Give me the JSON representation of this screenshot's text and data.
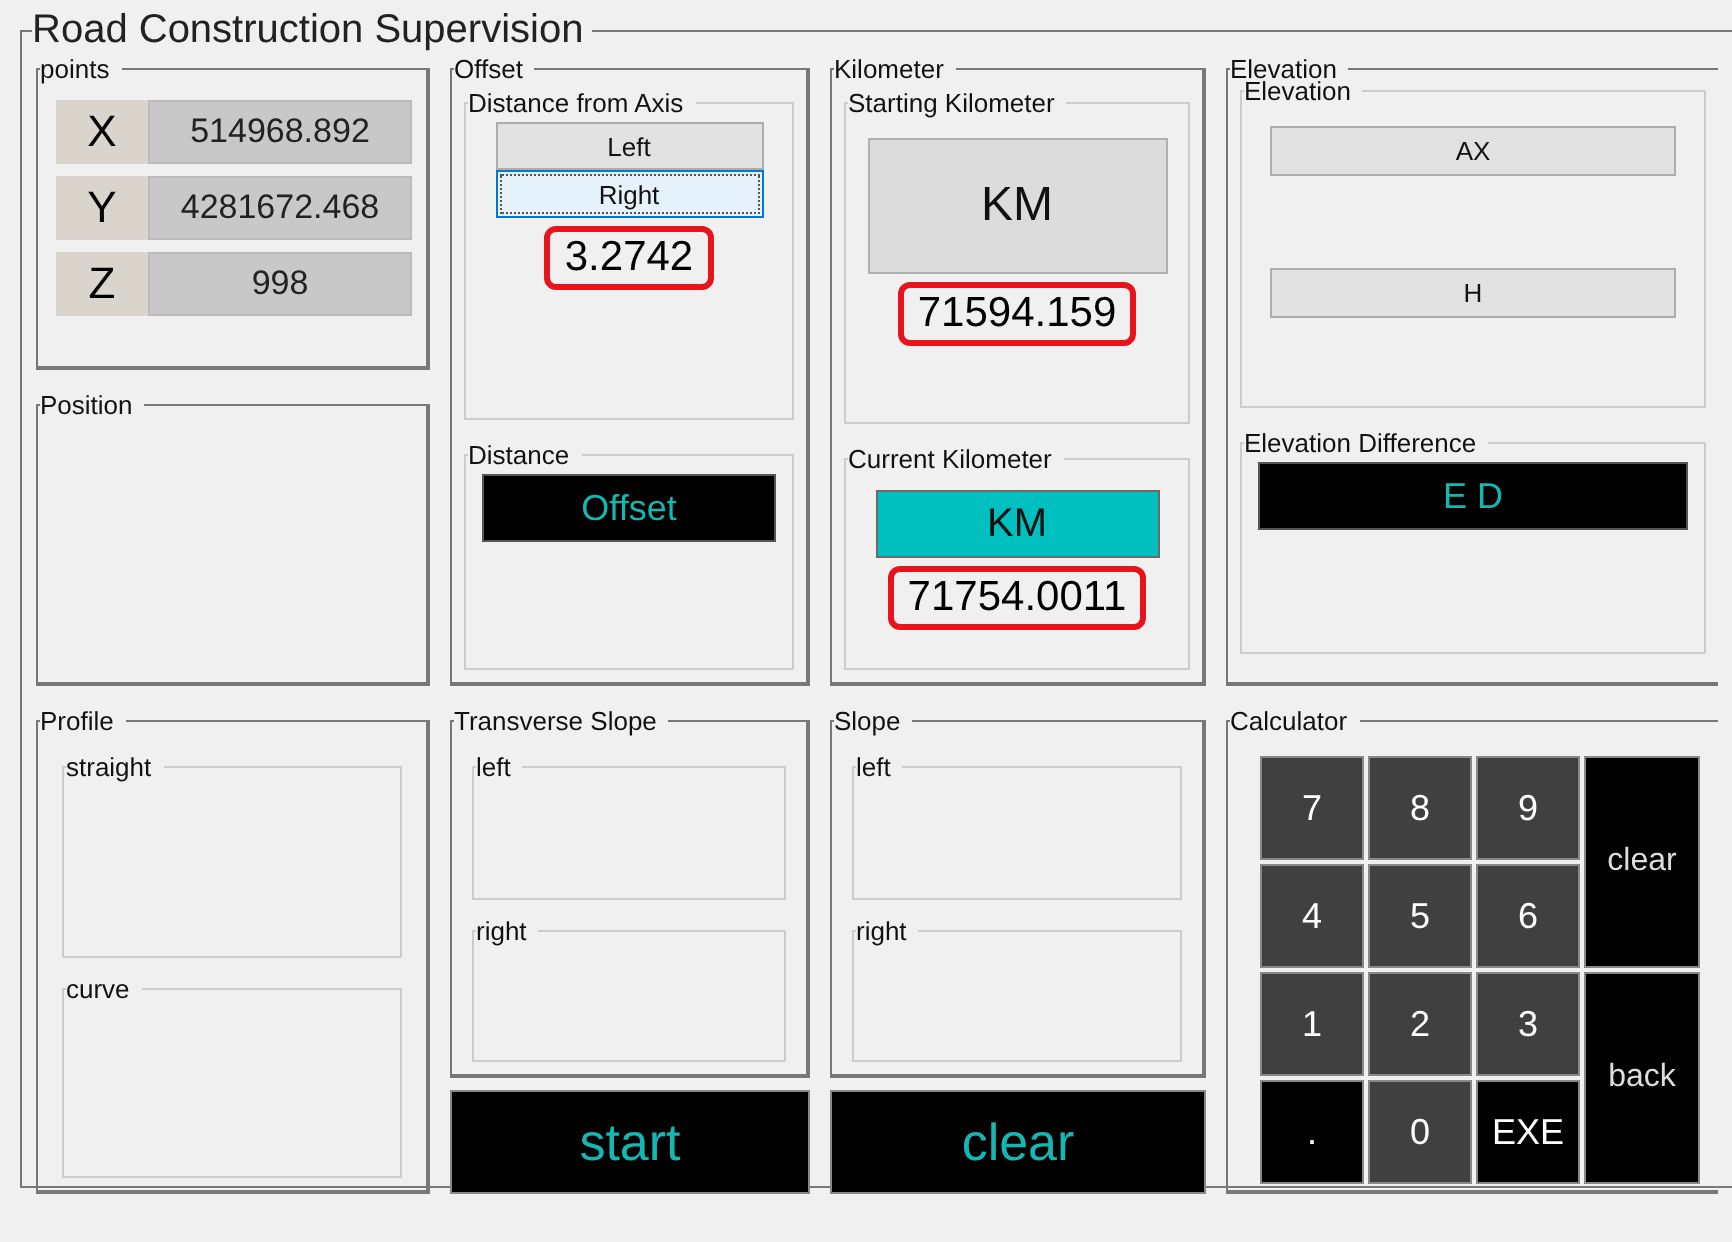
{
  "window": {
    "title": "Road Construction Supervision"
  },
  "points": {
    "title": "points",
    "rows": [
      {
        "axis": "X",
        "value": "514968.892"
      },
      {
        "axis": "Y",
        "value": "4281672.468"
      },
      {
        "axis": "Z",
        "value": "998"
      }
    ]
  },
  "position": {
    "title": "Position"
  },
  "offset": {
    "title": "Offset",
    "distance_from_axis": {
      "title": "Distance from Axis",
      "buttons": [
        {
          "label": "Left",
          "selected": false
        },
        {
          "label": "Right",
          "selected": true
        }
      ],
      "value": "3.2742",
      "highlighted": true
    },
    "distance": {
      "title": "Distance",
      "display": "Offset"
    }
  },
  "kilometer": {
    "title": "Kilometer",
    "sections": [
      {
        "title": "Starting Kilometer",
        "button": "KM",
        "active": false,
        "value": "71594.159",
        "highlighted": true
      },
      {
        "title": "Current Kilometer",
        "button": "KM",
        "active": true,
        "value": "71754.0011",
        "highlighted": true
      }
    ]
  },
  "elevation": {
    "title": "Elevation",
    "inner": {
      "title": "Elevation",
      "buttons": [
        "AX",
        "H"
      ]
    },
    "difference": {
      "title": "Elevation Difference",
      "display": "E D"
    }
  },
  "profile": {
    "title": "Profile",
    "groups": [
      "straight",
      "curve"
    ]
  },
  "transverse_slope": {
    "title": "Transverse Slope",
    "groups": [
      "left",
      "right"
    ],
    "button": "start"
  },
  "slope": {
    "title": "Slope",
    "groups": [
      "left",
      "right"
    ],
    "button": "clear"
  },
  "calculator": {
    "title": "Calculator",
    "keys": [
      {
        "label": "7",
        "kind": "digit"
      },
      {
        "label": "8",
        "kind": "digit"
      },
      {
        "label": "9",
        "kind": "digit"
      },
      {
        "label": "clear",
        "kind": "tall"
      },
      {
        "label": "4",
        "kind": "digit"
      },
      {
        "label": "5",
        "kind": "digit"
      },
      {
        "label": "6",
        "kind": "digit"
      },
      {
        "label": "1",
        "kind": "digit"
      },
      {
        "label": "2",
        "kind": "digit"
      },
      {
        "label": "3",
        "kind": "digit"
      },
      {
        "label": "back",
        "kind": "tall"
      },
      {
        "label": ".",
        "kind": "function"
      },
      {
        "label": "0",
        "kind": "digit"
      },
      {
        "label": "EXE",
        "kind": "function"
      }
    ]
  }
}
